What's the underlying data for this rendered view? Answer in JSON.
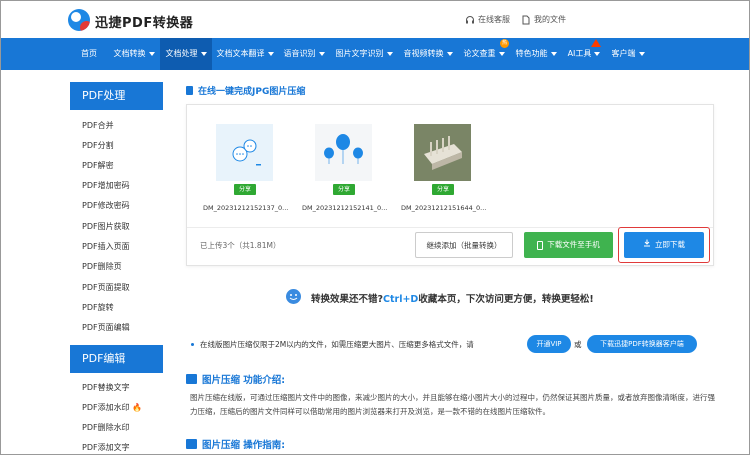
{
  "header": {
    "brand": "迅捷PDF转换器",
    "service_label": "在线客服",
    "files_label": "我的文件"
  },
  "nav": {
    "items": [
      {
        "label": "首页",
        "caret": false
      },
      {
        "label": "文档转换",
        "caret": true
      },
      {
        "label": "文档处理",
        "caret": true,
        "active": true
      },
      {
        "label": "文档文本翻译",
        "caret": true
      },
      {
        "label": "语音识别",
        "caret": true
      },
      {
        "label": "图片文字识别",
        "caret": true
      },
      {
        "label": "音视频转换",
        "caret": true
      },
      {
        "label": "论文查重",
        "caret": true
      },
      {
        "label": "特色功能",
        "caret": true
      },
      {
        "label": "AI工具",
        "caret": true
      },
      {
        "label": "客户端",
        "caret": true
      }
    ],
    "hot_badge": "热"
  },
  "sidebar": {
    "section1_title": "PDF处理",
    "section1_items": [
      "PDF合并",
      "PDF分割",
      "PDF解密",
      "PDF增加密码",
      "PDF修改密码",
      "PDF图片获取",
      "PDF插入页面",
      "PDF删除页",
      "PDF页面提取",
      "PDF旋转",
      "PDF页面编辑"
    ],
    "section2_title": "PDF编辑",
    "section2_items": [
      "PDF替换文字",
      "PDF添加水印",
      "PDF删除水印",
      "PDF添加文字"
    ]
  },
  "main": {
    "title": "在线一键完成JPG图片压缩",
    "files": [
      {
        "name": "DM_20231212152137_0...",
        "share": "分享"
      },
      {
        "name": "DM_20231212152141_0...",
        "share": "分享"
      },
      {
        "name": "DM_20231212151644_0...",
        "share": "分享"
      }
    ],
    "uploaded_text": "已上传3个（共1.81M）",
    "continue_button": "继续添加（批量转换）",
    "phone_button": "下载文件至手机",
    "download_button": "立即下载",
    "fav_prefix": "转换效果还不错?",
    "fav_key": "Ctrl+D",
    "fav_suffix": "收藏本页，下次访问更方便，转换更轻松!",
    "notice_text": "在线版图片压缩仅限于2M以内的文件，如需压缩更大图片、压缩更多格式文件，请",
    "vip_button": "开通VIP",
    "or_text": "或",
    "client_button": "下载迅捷PDF转换器客户端",
    "intro_title": "图片压缩 功能介绍:",
    "intro_text": "图片压缩在线版，可通过压缩图片文件中的图像，来减少图片的大小，并且能够在缩小图片大小的过程中，仍然保证其图片质量，或者放弃图像清晰度，进行强力压缩，压缩后的图片文件同样可以借助常用的图片浏览器来打开及浏览，是一款不错的在线图片压缩软件。",
    "guide_title": "图片压缩 操作指南:"
  },
  "colors": {
    "brand_blue": "#1877d6",
    "download_blue": "#1e88e5",
    "share_green": "#2fa832",
    "phone_green": "#3fb34f",
    "highlight_red": "#e03a3a"
  }
}
